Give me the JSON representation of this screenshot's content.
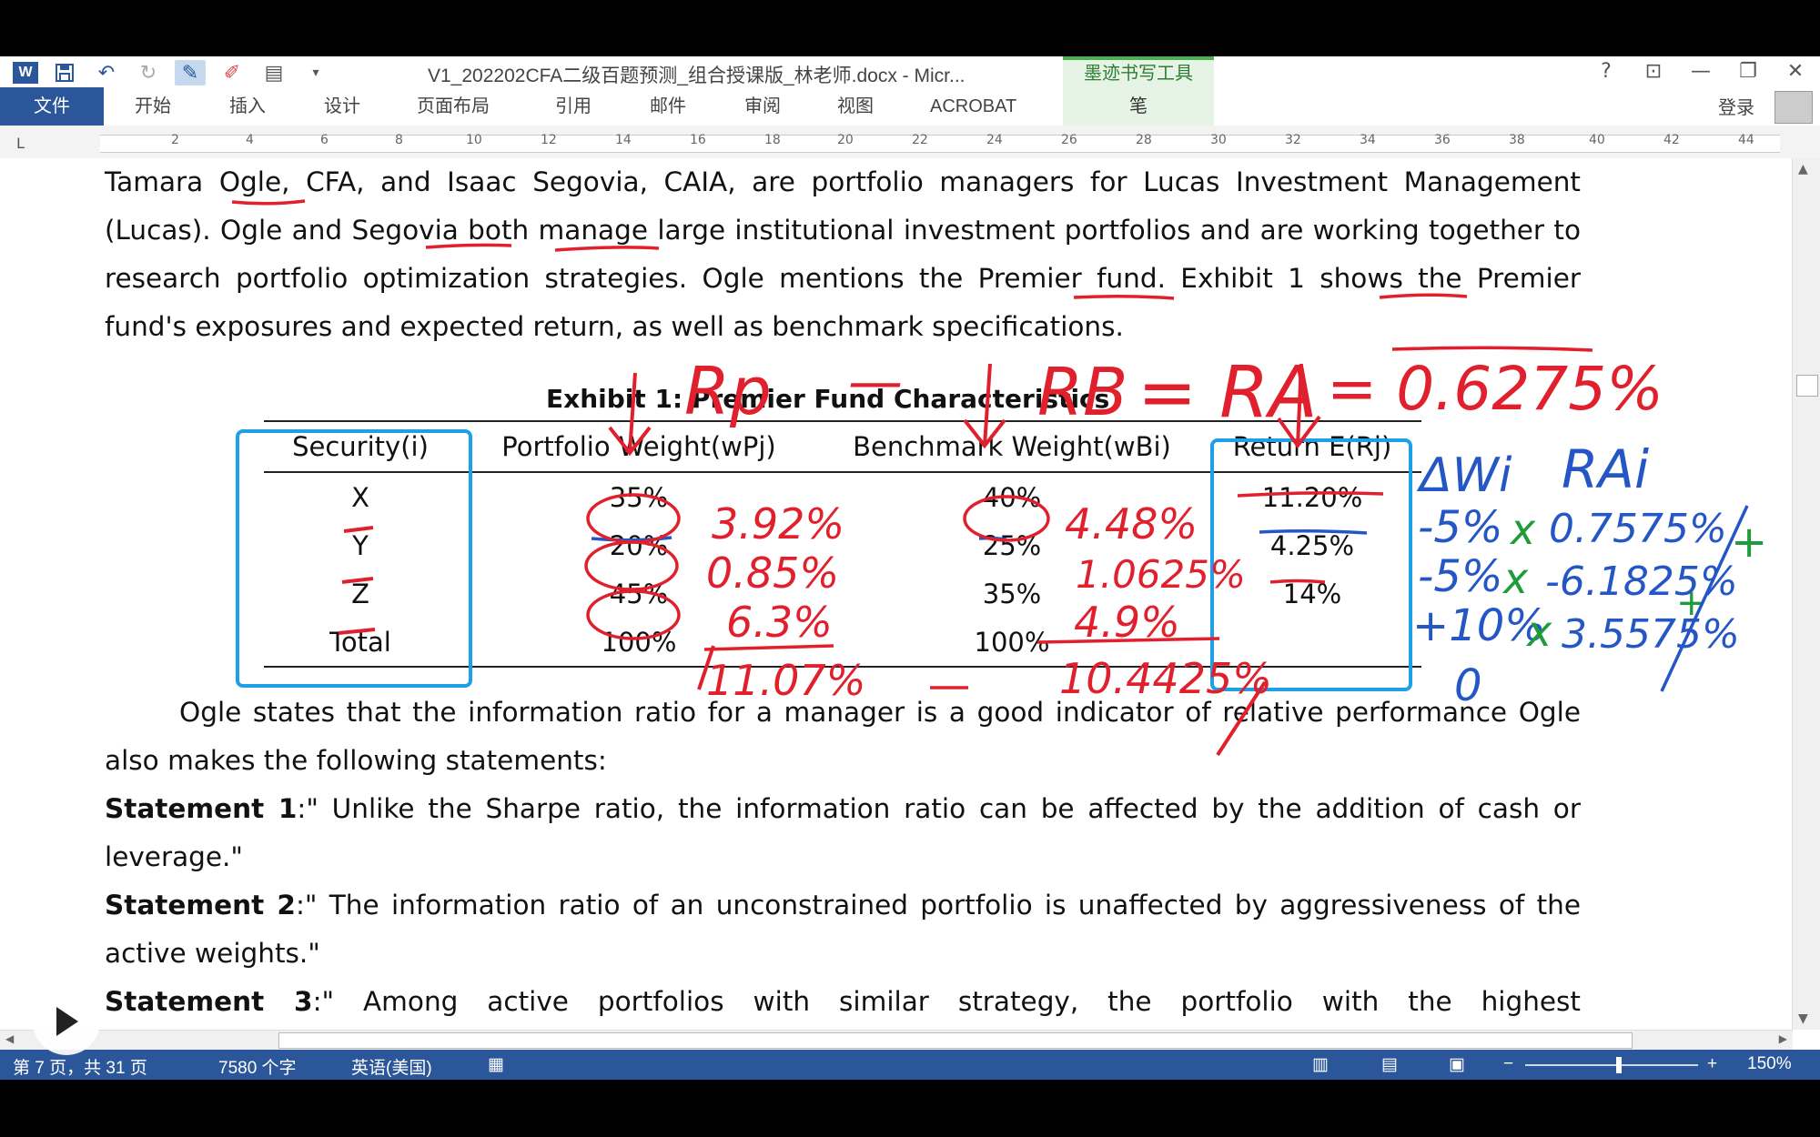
{
  "window": {
    "doc_title": "V1_202202CFA二级百题预测_组合授课版_林老师.docx - Micr...",
    "ink_tools_tab": "墨迹书写工具",
    "help": "?",
    "controls": [
      "?",
      "⊡",
      "—",
      "❐",
      "✕"
    ]
  },
  "ribbon": {
    "tabs": [
      "文件",
      "开始",
      "插入",
      "设计",
      "页面布局",
      "引用",
      "邮件",
      "审阅",
      "视图",
      "ACROBAT"
    ],
    "pen_tab": "笔",
    "login": "登录"
  },
  "ruler": {
    "ticks": [
      "2",
      "4",
      "6",
      "8",
      "10",
      "12",
      "14",
      "16",
      "18",
      "20",
      "22",
      "24",
      "26",
      "28",
      "30",
      "32",
      "34",
      "36",
      "38",
      "40",
      "42",
      "44"
    ],
    "corner": "L"
  },
  "document": {
    "intro": "Tamara Ogle, CFA, and Isaac Segovia, CAIA, are portfolio managers for Lucas Investment Management (Lucas). Ogle and Segovia both manage large institutional investment portfolios and are working together to research portfolio optimization strategies. Ogle mentions the Premier fund. Exhibit 1 shows the Premier fund's exposures and expected return, as well as benchmark specifications.",
    "exhibit_title": "Exhibit 1: Premier Fund Characteristics",
    "table": {
      "headers": [
        "Security(i)",
        "Portfolio Weight(wPj)",
        "Benchmark Weight(wBi)",
        "Return E(Rj)"
      ],
      "rows": [
        [
          "X",
          "35%",
          "40%",
          "11.20%"
        ],
        [
          "Y",
          "20%",
          "25%",
          "4.25%"
        ],
        [
          "Z",
          "45%",
          "35%",
          "14%"
        ],
        [
          "Total",
          "100%",
          "100%",
          ""
        ]
      ]
    },
    "para2": "Ogle states that the information ratio for a manager is a good indicator of relative performance Ogle also makes the following statements:",
    "statements": [
      {
        "label": "Statement 1",
        "text": ":\" Unlike the Sharpe ratio, the information ratio can be affected by the addition of cash or leverage.\""
      },
      {
        "label": "Statement 2",
        "text": ":\" The information ratio of an unconstrained portfolio is unaffected by aggressiveness of the active weights.\""
      },
      {
        "label": "Statement 3",
        "text": ":\" Among active portfolios with similar strategy, the portfolio with the highest"
      }
    ]
  },
  "ink_annotations": {
    "formula_rp": "Rp",
    "formula_minus": "—",
    "formula_rb": "RB",
    "formula_eq1": "= RA",
    "formula_eq2": "= 0.6275%",
    "port_contrib": [
      "3.92%",
      "0.85%",
      "6.3%",
      "11.07%"
    ],
    "bench_contrib": [
      "4.48%",
      "1.0625%",
      "4.9%",
      "10.4425%"
    ],
    "delta_w_header": "ΔWi",
    "ra_header": "RAi",
    "delta_w": [
      "-5%",
      "-5%",
      "+10%",
      "0"
    ],
    "ra_values": [
      "0.7575%",
      "-6.1825%",
      "3.5575%"
    ],
    "times": "x",
    "plus": "+"
  },
  "status": {
    "page": "第 7 页，共 31 页",
    "words": "7580 个字",
    "language": "英语(美国)",
    "zoom": "150%"
  },
  "colors": {
    "word_blue": "#2b579a",
    "ink_red": "#e0202c",
    "ink_blue": "#2457c5",
    "ink_green": "#1f9c3a",
    "highlight_cyan": "#1ea0e6"
  }
}
